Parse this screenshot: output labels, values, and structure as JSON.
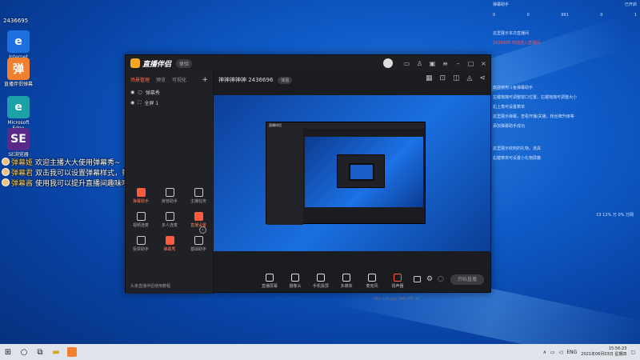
{
  "desktop": {
    "icons": [
      {
        "label": "Internet Explorer",
        "name": "internet-explorer-icon",
        "glyph": "e",
        "bg": "#1e6fe0"
      },
      {
        "label": "直播伴侣弹幕",
        "name": "danmaku-app-icon",
        "glyph": "弹",
        "bg": "#f08030"
      },
      {
        "label": "Microsoft Edge",
        "name": "edge-icon",
        "glyph": "e",
        "bg": "#1da1a8"
      },
      {
        "label": "SE浏览器",
        "name": "se-browser-icon",
        "glyph": "SE",
        "bg": "#5a2a8a"
      }
    ],
    "overlay_id": "2436695",
    "overlay_top": "活动"
  },
  "danmaku": [
    {
      "name": "弹幕姬",
      "name_color": "#ffd060",
      "text": "欢迎主播大大使用弹幕秀~"
    },
    {
      "name": "弹幕君",
      "name_color": "#ffd060",
      "text": "双击我可以设置弹幕样式，筛选展示哦~"
    },
    {
      "name": "弹幕酱",
      "name_color": "#ffd060",
      "text": "使用我可以提升直播间趣味哦(#^0^#)"
    }
  ],
  "app": {
    "logo_text": "直播伴侣",
    "version": "体验",
    "sidebar_tabs": [
      "场景管理",
      "预览",
      "可视化"
    ],
    "sources": [
      "弹幕秀",
      "全屏 1"
    ],
    "tools": [
      {
        "label": "弹幕助手",
        "red": true
      },
      {
        "label": "房管助手",
        "red": false
      },
      {
        "label": "主播任务",
        "red": false
      },
      {
        "label": "视频连麦",
        "red": false
      },
      {
        "label": "多人连麦",
        "red": false
      },
      {
        "label": "直播设置",
        "red": true
      },
      {
        "label": "投票助手",
        "red": false
      },
      {
        "label": "弹幕秀",
        "red": true
      },
      {
        "label": "基础助手",
        "red": false
      }
    ],
    "sidebar_footer": "头条直播伴侣使用教程",
    "room_name": "神神神神神 2436696",
    "room_badge": "体验",
    "controls": [
      {
        "label": "直播屏幕",
        "red": false
      },
      {
        "label": "摄像头",
        "red": false
      },
      {
        "label": "手机投屏",
        "red": false
      },
      {
        "label": "多媒体",
        "red": false
      },
      {
        "label": "麦克风",
        "red": false
      },
      {
        "label": "扬声器",
        "red": true
      }
    ],
    "start_button": "开始直播",
    "status": "CPU: 12%   内存: 59%   FPS: 30"
  },
  "right_panel": {
    "title": "弹幕助手",
    "top_right": "已开启",
    "stats": [
      "0",
      "0",
      "991",
      "0",
      "1"
    ],
    "lines": [
      {
        "text": "这里展示本次直播间",
        "hl": false
      },
      {
        "text": "2436695 欢迎进入直播间",
        "hl": true
      },
      {
        "text": "欢迎使用斗鱼弹幕助手",
        "hl": false
      },
      {
        "text": "左键拖拽可调整窗口位置，右键拖拽可调整大小",
        "hl": false
      },
      {
        "text": "右上角可设置菜单",
        "hl": false
      },
      {
        "text": "这里展示弹幕，查看开播/关播，粉丝牌升级等",
        "hl": false
      },
      {
        "text": "添加弹幕助手成功",
        "hl": false
      },
      {
        "text": "这里展示收到的礼物，道具",
        "hl": false
      },
      {
        "text": "右键菜单可设置小礼物屏蔽",
        "hl": false
      }
    ],
    "meter": "13 12% 万 0% 万网"
  },
  "taskbar": {
    "lang": "ENG",
    "time": "15:56:23",
    "date": "2021年06月03日 星期四"
  }
}
